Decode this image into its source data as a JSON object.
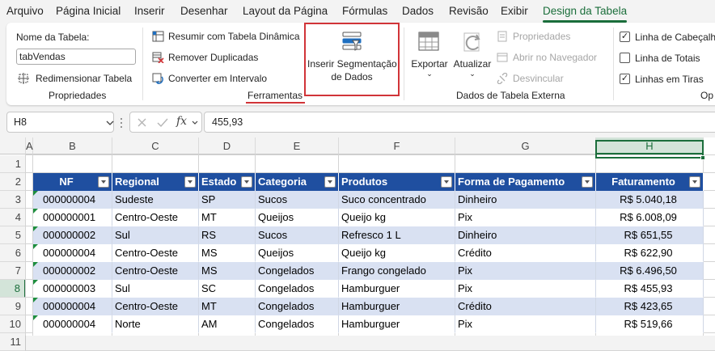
{
  "menu": {
    "tabs": [
      "Arquivo",
      "Página Inicial",
      "Inserir",
      "Desenhar",
      "Layout da Página",
      "Fórmulas",
      "Dados",
      "Revisão",
      "Exibir",
      "Design da Tabela"
    ],
    "active_index": 9
  },
  "ribbon": {
    "propriedades": {
      "name_label": "Nome da Tabela:",
      "name_value": "tabVendas",
      "resize_label": "Redimensionar Tabela",
      "group_label": "Propriedades"
    },
    "ferramentas": {
      "pivot_label": "Resumir com Tabela Dinâmica",
      "dedupe_label": "Remover Duplicadas",
      "convert_label": "Converter em Intervalo",
      "slicer_label_1": "Inserir Segmentação",
      "slicer_label_2": "de Dados",
      "group_label": "Ferramentas",
      "highlight_color": "#d13438"
    },
    "externos": {
      "export_label": "Exportar",
      "refresh_label": "Atualizar",
      "props_label": "Propriedades",
      "browser_label": "Abrir no Navegador",
      "unlink_label": "Desvincular",
      "group_label": "Dados de Tabela Externa"
    },
    "estilo": {
      "header_row_label": "Linha de Cabeçalho",
      "total_row_label": "Linha de Totais",
      "banded_rows_label": "Linhas em Tiras",
      "header_row_checked": true,
      "total_row_checked": false,
      "banded_rows_checked": true,
      "group_label": "Op"
    }
  },
  "formula_bar": {
    "cell_ref": "H8",
    "value": "455,93"
  },
  "sheet": {
    "columns": [
      "A",
      "B",
      "C",
      "D",
      "E",
      "F",
      "G",
      "H"
    ],
    "selected_column": "H",
    "rows": [
      "1",
      "2",
      "3",
      "4",
      "5",
      "6",
      "7",
      "8",
      "9",
      "10",
      "11"
    ],
    "selected_row": "8",
    "header": [
      "NF",
      "Regional",
      "Estado",
      "Categoria",
      "Produtos",
      "Forma de Pagamento",
      "Faturamento"
    ],
    "data": [
      [
        "000000004",
        "Sudeste",
        "SP",
        "Sucos",
        "Suco concentrado",
        "Dinheiro",
        "R$ 5.040,18"
      ],
      [
        "000000001",
        "Centro-Oeste",
        "MT",
        "Queijos",
        "Queijo kg",
        "Pix",
        "R$ 6.008,09"
      ],
      [
        "000000002",
        "Sul",
        "RS",
        "Sucos",
        "Refresco 1 L",
        "Dinheiro",
        "R$ 651,55"
      ],
      [
        "000000004",
        "Centro-Oeste",
        "MS",
        "Queijos",
        "Queijo kg",
        "Crédito",
        "R$ 622,90"
      ],
      [
        "000000002",
        "Centro-Oeste",
        "MS",
        "Congelados",
        "Frango congelado",
        "Pix",
        "R$ 6.496,50"
      ],
      [
        "000000003",
        "Sul",
        "SC",
        "Congelados",
        "Hamburguer",
        "Pix",
        "R$ 455,93"
      ],
      [
        "000000004",
        "Centro-Oeste",
        "MT",
        "Congelados",
        "Hamburguer",
        "Crédito",
        "R$ 423,65"
      ],
      [
        "000000004",
        "Norte",
        "AM",
        "Congelados",
        "Hamburguer",
        "Pix",
        "R$ 519,66"
      ]
    ],
    "header_color": "#1f4fa0",
    "band_color": "#d9e1f2",
    "accent_color": "#1b6e3b"
  }
}
